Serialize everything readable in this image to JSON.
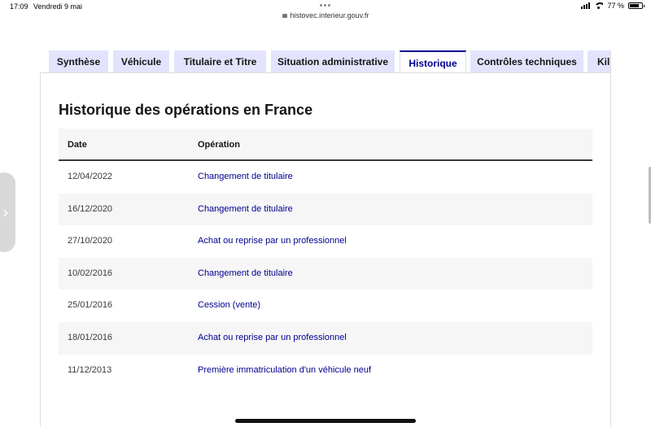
{
  "status_bar": {
    "time": "17:09",
    "date": "Vendredi 9 mai",
    "url": "histovec.interieur.gouv.fr",
    "battery": "77 %",
    "battery_level": 0.77
  },
  "tabs": [
    {
      "label": "Synthèse",
      "active": false
    },
    {
      "label": "Véhicule",
      "active": false
    },
    {
      "label": "Titulaire et Titre",
      "active": false
    },
    {
      "label": "Situation administrative",
      "active": false
    },
    {
      "label": "Historique",
      "active": true
    },
    {
      "label": "Contrôles techniques",
      "active": false
    },
    {
      "label": "Kilo",
      "active": false
    }
  ],
  "panel": {
    "title": "Historique des opérations en France"
  },
  "table": {
    "headers": {
      "date": "Date",
      "operation": "Opération"
    },
    "rows": [
      {
        "date": "12/04/2022",
        "operation": "Changement de titulaire"
      },
      {
        "date": "16/12/2020",
        "operation": "Changement de titulaire"
      },
      {
        "date": "27/10/2020",
        "operation": "Achat ou reprise par un professionnel"
      },
      {
        "date": "10/02/2016",
        "operation": "Changement de titulaire"
      },
      {
        "date": "25/01/2016",
        "operation": "Cession (vente)"
      },
      {
        "date": "18/01/2016",
        "operation": "Achat ou reprise par un professionnel"
      },
      {
        "date": "11/12/2013",
        "operation": "Première immatriculation d'un véhicule neuf"
      }
    ]
  },
  "colors": {
    "accent": "#000091",
    "tab_bg": "#e3e3fd",
    "row_alt": "#f6f6f6"
  }
}
